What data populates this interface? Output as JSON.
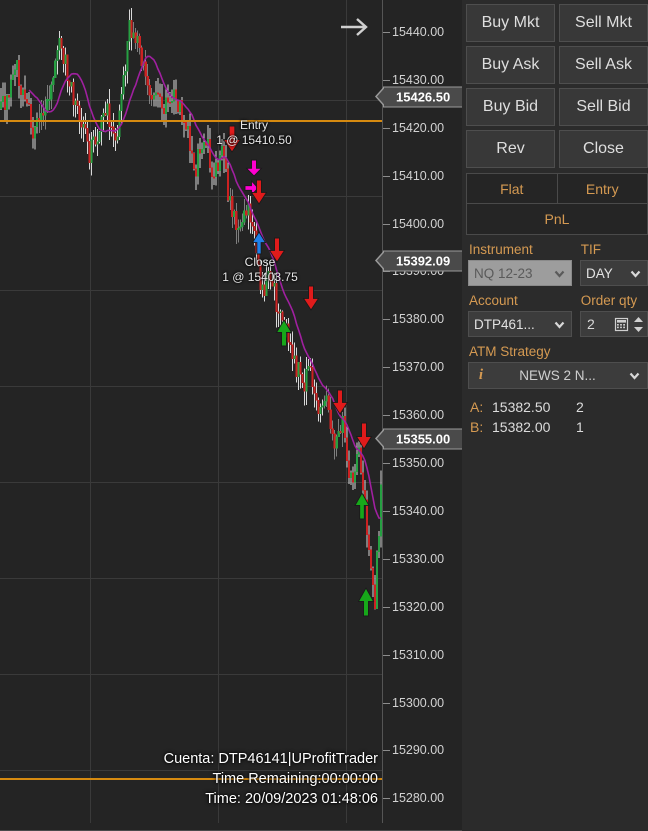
{
  "chart": {
    "forward_arrow_icon": "arrow-right-icon",
    "background": "#242424",
    "up_candle_color": "#26a042",
    "down_candle_color": "#cc2222",
    "ma_line_color": "#a020a0",
    "hline_color": "#d68a10",
    "annotations": [
      {
        "title": "Entry",
        "detail": "1 @ 15410.50"
      },
      {
        "title": "Close",
        "detail": "1 @ 15403.75"
      }
    ],
    "footer": {
      "account_line": "Cuenta: DTP46141|UProfitTrader",
      "time_remaining_line": "Time Remaining:00:00:00",
      "time_line": "Time: 20/09/2023 01:48:06"
    },
    "price_axis": {
      "ticks": [
        "15440.00",
        "15430.00",
        "15420.00",
        "15410.00",
        "15400.00",
        "15390.00",
        "15380.00",
        "15370.00",
        "15360.00",
        "15350.00",
        "15340.00",
        "15330.00",
        "15320.00",
        "15310.00",
        "15300.00",
        "15290.00",
        "15280.00"
      ],
      "tags": [
        {
          "value": "15426.50",
          "kind": "orange-line-price"
        },
        {
          "value": "15392.09",
          "kind": "last-price"
        },
        {
          "value": "15355.00",
          "kind": "bid-ask-price"
        }
      ]
    }
  },
  "panel": {
    "order_buttons": [
      {
        "label": "Buy Mkt",
        "name": "buy-market-button"
      },
      {
        "label": "Sell Mkt",
        "name": "sell-market-button"
      },
      {
        "label": "Buy Ask",
        "name": "buy-ask-button"
      },
      {
        "label": "Sell Ask",
        "name": "sell-ask-button"
      },
      {
        "label": "Buy Bid",
        "name": "buy-bid-button"
      },
      {
        "label": "Sell Bid",
        "name": "sell-bid-button"
      },
      {
        "label": "Rev",
        "name": "reverse-button"
      },
      {
        "label": "Close",
        "name": "close-position-button"
      }
    ],
    "tabs": {
      "flat": "Flat",
      "entry": "Entry",
      "pnl": "PnL"
    },
    "instrument": {
      "label": "Instrument",
      "value": "NQ 12-23"
    },
    "tif": {
      "label": "TIF",
      "value": "DAY"
    },
    "account": {
      "label": "Account",
      "value": "DTP461..."
    },
    "order_qty": {
      "label": "Order qty",
      "value": "2"
    },
    "atm_strategy": {
      "label": "ATM Strategy",
      "value": "NEWS 2 N...",
      "info_icon": "info-icon"
    },
    "market_depth": [
      {
        "key": "A:",
        "price": "15382.50",
        "qty": "2"
      },
      {
        "key": "B:",
        "price": "15382.00",
        "qty": "1"
      }
    ],
    "accent_color": "#d59a52"
  }
}
